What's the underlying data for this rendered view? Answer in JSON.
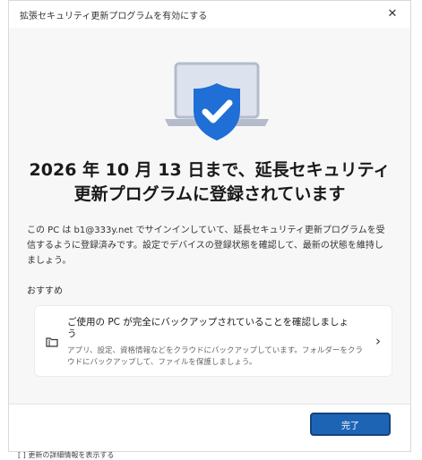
{
  "window": {
    "title": "拡張セキュリティ更新プログラムを有効にする",
    "close_icon": "close-icon",
    "close_glyph": "✕"
  },
  "hero": {
    "icon": "laptop-shield-check-icon",
    "colors": {
      "laptop_screen": "#dde3ee",
      "laptop_frame": "#b4bccb",
      "shield": "#1f6fd6",
      "check": "#ffffff"
    }
  },
  "heading": "2026 年 10 月 13 日まで、延長セキュリティ更新プログラムに登録されています",
  "description": "この PC は b1@333y.net でサインインしていて、延長セキュリティ更新プログラムを受信するように登録済みです。設定でデバイスの登録状態を確認して、最新の状態を維持しましょう。",
  "recommended": {
    "label": "おすすめ",
    "card": {
      "icon": "backup-folder-icon",
      "title": "ご使用の PC が完全にバックアップされていることを確認しましょう",
      "description": "アプリ、設定、資格情報などをクラウドにバックアップしています。フォルダーをクラウドにバックアップして、ファイルを保護しましょう。",
      "chevron_icon": "chevron-right-icon",
      "chevron_glyph": "›"
    }
  },
  "footer": {
    "done_label": "完了",
    "accent": "#1e64b5"
  },
  "below_text": "[ ] 更新の詳細情報を表示する"
}
